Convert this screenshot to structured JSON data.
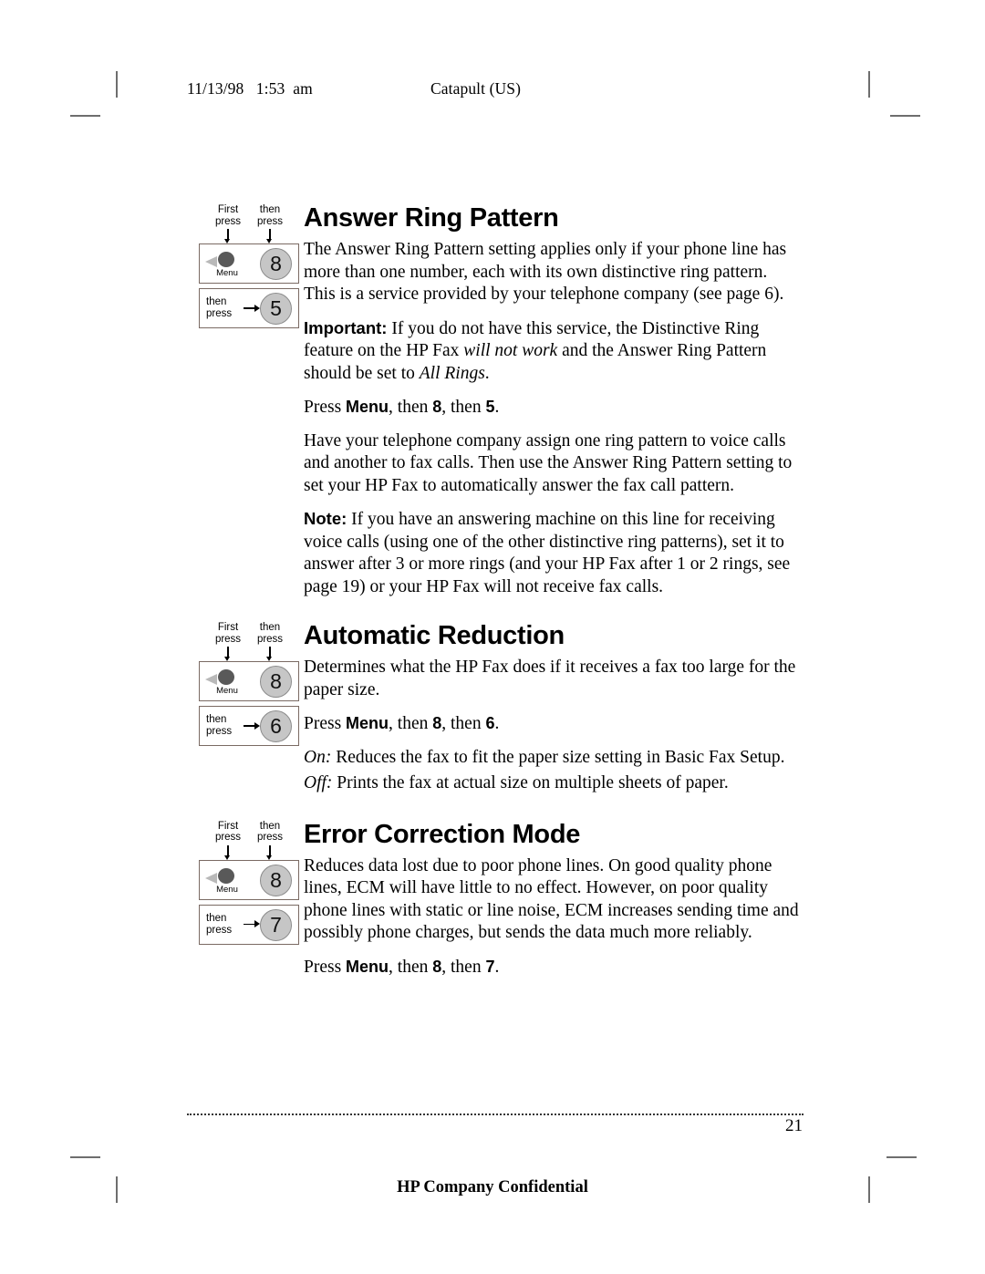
{
  "header": {
    "date": "11/13/98   1:53  am",
    "project": "Catapult (US)"
  },
  "footer": {
    "page_number": "21",
    "confidential_notice": "HP Company Confidential"
  },
  "key_diagram_labels": {
    "first_press": "First\npress",
    "then_press": "then\npress",
    "then_press_inline": "then\npress",
    "menu_label": "Menu"
  },
  "sections": [
    {
      "heading": "Answer Ring Pattern",
      "keys": {
        "step1": "8",
        "step2": "5"
      },
      "paragraphs": [
        {
          "id": "intro",
          "text": "The Answer Ring Pattern setting applies only if your phone line has more than one number, each with its own distinctive ring pattern. This is a service provided by your telephone company (see page 6)."
        },
        {
          "id": "important",
          "lead": "Important:",
          "part1": " If you do not have this service, the Distinctive Ring feature on the HP Fax ",
          "italic1": "will not work",
          "part2": " and the Answer Ring Pattern should be set to ",
          "italic2": "All Rings",
          "part3": "."
        },
        {
          "id": "press",
          "pre": "Press ",
          "key_menu": "Menu",
          "mid1": ", then ",
          "key_a": "8",
          "mid2": ", then ",
          "key_b": "5",
          "post": "."
        },
        {
          "id": "assign",
          "text": "Have your telephone company assign one ring pattern to voice calls and another to fax calls. Then use the Answer Ring Pattern setting to set your HP Fax to automatically answer the fax call pattern."
        },
        {
          "id": "note",
          "lead": "Note:",
          "text": " If you have an answering machine on this line for receiving voice calls (using one of the other distinctive ring patterns), set it to answer after 3 or more rings (and your HP Fax after 1 or 2 rings, see page 19) or your HP Fax will not receive fax calls."
        }
      ]
    },
    {
      "heading": "Automatic Reduction",
      "keys": {
        "step1": "8",
        "step2": "6"
      },
      "paragraphs": [
        {
          "id": "intro",
          "text": "Determines what the HP Fax does if it receives a fax too large for the paper size."
        },
        {
          "id": "press",
          "pre": "Press ",
          "key_menu": "Menu",
          "mid1": ", then ",
          "key_a": "8",
          "mid2": ", then ",
          "key_b": "6",
          "post": "."
        },
        {
          "id": "on",
          "italic_lead": "On:",
          "text": "  Reduces the fax to fit the paper size setting in Basic Fax Setup."
        },
        {
          "id": "off",
          "italic_lead": "Off:",
          "text": "  Prints the fax at actual size on multiple sheets of paper."
        }
      ]
    },
    {
      "heading": "Error Correction Mode",
      "keys": {
        "step1": "8",
        "step2": "7"
      },
      "paragraphs": [
        {
          "id": "intro",
          "text": "Reduces data lost due to poor phone lines. On good quality phone lines, ECM will have little to no effect. However, on poor quality phone lines with static or line noise, ECM increases sending time and possibly phone charges, but sends the data much more reliably."
        },
        {
          "id": "press",
          "pre": "Press ",
          "key_menu": "Menu",
          "mid1": ", then ",
          "key_a": "8",
          "mid2": ", then ",
          "key_b": "7",
          "post": "."
        }
      ]
    }
  ]
}
